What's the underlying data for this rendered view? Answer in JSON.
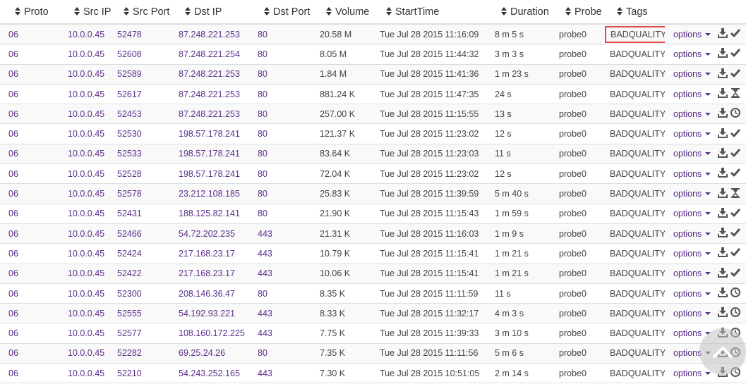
{
  "columns": [
    {
      "key": "proto",
      "label": "Proto"
    },
    {
      "key": "src_ip",
      "label": "Src IP"
    },
    {
      "key": "src_port",
      "label": "Src Port"
    },
    {
      "key": "dst_ip",
      "label": "Dst IP"
    },
    {
      "key": "dst_port",
      "label": "Dst Port"
    },
    {
      "key": "volume",
      "label": "Volume"
    },
    {
      "key": "start_time",
      "label": "StartTime"
    },
    {
      "key": "duration",
      "label": "Duration"
    },
    {
      "key": "probe",
      "label": "Probe"
    },
    {
      "key": "tags",
      "label": "Tags"
    }
  ],
  "options_label": "options",
  "highlighted_row": 0,
  "colors": {
    "link": "#5d2f8a",
    "highlight": "#e04a4a",
    "icon": "#555555"
  },
  "rows": [
    {
      "proto": "06",
      "src_ip": "10.0.0.45",
      "src_port": "52478",
      "dst_ip": "87.248.221.253",
      "dst_port": "80",
      "volume": "20.58 M",
      "start_time": "Tue Jul 28 2015 11:16:09",
      "duration": "8 m 5 s",
      "probe": "probe0",
      "tags": "BADQUALITY",
      "status": "check-icon"
    },
    {
      "proto": "06",
      "src_ip": "10.0.0.45",
      "src_port": "52608",
      "dst_ip": "87.248.221.254",
      "dst_port": "80",
      "volume": "8.05 M",
      "start_time": "Tue Jul 28 2015 11:44:32",
      "duration": "3 m 3 s",
      "probe": "probe0",
      "tags": "BADQUALITY",
      "status": "check-icon"
    },
    {
      "proto": "06",
      "src_ip": "10.0.0.45",
      "src_port": "52589",
      "dst_ip": "87.248.221.253",
      "dst_port": "80",
      "volume": "1.84 M",
      "start_time": "Tue Jul 28 2015 11:41:36",
      "duration": "1 m 23 s",
      "probe": "probe0",
      "tags": "BADQUALITY",
      "status": "check-icon"
    },
    {
      "proto": "06",
      "src_ip": "10.0.0.45",
      "src_port": "52617",
      "dst_ip": "87.248.221.253",
      "dst_port": "80",
      "volume": "881.24 K",
      "start_time": "Tue Jul 28 2015 11:47:35",
      "duration": "24 s",
      "probe": "probe0",
      "tags": "BADQUALITY",
      "status": "hourglass-icon"
    },
    {
      "proto": "06",
      "src_ip": "10.0.0.45",
      "src_port": "52453",
      "dst_ip": "87.248.221.253",
      "dst_port": "80",
      "volume": "257.00 K",
      "start_time": "Tue Jul 28 2015 11:15:55",
      "duration": "13 s",
      "probe": "probe0",
      "tags": "BADQUALITY",
      "status": "clock-icon"
    },
    {
      "proto": "06",
      "src_ip": "10.0.0.45",
      "src_port": "52530",
      "dst_ip": "198.57.178.241",
      "dst_port": "80",
      "volume": "121.37 K",
      "start_time": "Tue Jul 28 2015 11:23:02",
      "duration": "12 s",
      "probe": "probe0",
      "tags": "BADQUALITY",
      "status": "check-icon"
    },
    {
      "proto": "06",
      "src_ip": "10.0.0.45",
      "src_port": "52533",
      "dst_ip": "198.57.178.241",
      "dst_port": "80",
      "volume": "83.64 K",
      "start_time": "Tue Jul 28 2015 11:23:03",
      "duration": "11 s",
      "probe": "probe0",
      "tags": "BADQUALITY",
      "status": "check-icon"
    },
    {
      "proto": "06",
      "src_ip": "10.0.0.45",
      "src_port": "52528",
      "dst_ip": "198.57.178.241",
      "dst_port": "80",
      "volume": "72.04 K",
      "start_time": "Tue Jul 28 2015 11:23:02",
      "duration": "12 s",
      "probe": "probe0",
      "tags": "BADQUALITY",
      "status": "check-icon"
    },
    {
      "proto": "06",
      "src_ip": "10.0.0.45",
      "src_port": "52578",
      "dst_ip": "23.212.108.185",
      "dst_port": "80",
      "volume": "25.83 K",
      "start_time": "Tue Jul 28 2015 11:39:59",
      "duration": "5 m 40 s",
      "probe": "probe0",
      "tags": "BADQUALITY",
      "status": "hourglass-icon"
    },
    {
      "proto": "06",
      "src_ip": "10.0.0.45",
      "src_port": "52431",
      "dst_ip": "188.125.82.141",
      "dst_port": "80",
      "volume": "21.90 K",
      "start_time": "Tue Jul 28 2015 11:15:43",
      "duration": "1 m 59 s",
      "probe": "probe0",
      "tags": "BADQUALITY",
      "status": "check-icon"
    },
    {
      "proto": "06",
      "src_ip": "10.0.0.45",
      "src_port": "52466",
      "dst_ip": "54.72.202.235",
      "dst_port": "443",
      "volume": "21.31 K",
      "start_time": "Tue Jul 28 2015 11:16:03",
      "duration": "1 m 9 s",
      "probe": "probe0",
      "tags": "BADQUALITY",
      "status": "check-icon"
    },
    {
      "proto": "06",
      "src_ip": "10.0.0.45",
      "src_port": "52424",
      "dst_ip": "217.168.23.17",
      "dst_port": "443",
      "volume": "10.79 K",
      "start_time": "Tue Jul 28 2015 11:15:41",
      "duration": "1 m 21 s",
      "probe": "probe0",
      "tags": "BADQUALITY",
      "status": "check-icon"
    },
    {
      "proto": "06",
      "src_ip": "10.0.0.45",
      "src_port": "52422",
      "dst_ip": "217.168.23.17",
      "dst_port": "443",
      "volume": "10.06 K",
      "start_time": "Tue Jul 28 2015 11:15:41",
      "duration": "1 m 21 s",
      "probe": "probe0",
      "tags": "BADQUALITY",
      "status": "check-icon"
    },
    {
      "proto": "06",
      "src_ip": "10.0.0.45",
      "src_port": "52300",
      "dst_ip": "208.146.36.47",
      "dst_port": "80",
      "volume": "8.35 K",
      "start_time": "Tue Jul 28 2015 11:11:59",
      "duration": "11 s",
      "probe": "probe0",
      "tags": "BADQUALITY",
      "status": "clock-icon"
    },
    {
      "proto": "06",
      "src_ip": "10.0.0.45",
      "src_port": "52555",
      "dst_ip": "54.192.93.221",
      "dst_port": "443",
      "volume": "8.33 K",
      "start_time": "Tue Jul 28 2015 11:32:17",
      "duration": "4 m 3 s",
      "probe": "probe0",
      "tags": "BADQUALITY",
      "status": "clock-icon"
    },
    {
      "proto": "06",
      "src_ip": "10.0.0.45",
      "src_port": "52577",
      "dst_ip": "108.160.172.225",
      "dst_port": "443",
      "volume": "7.75 K",
      "start_time": "Tue Jul 28 2015 11:39:33",
      "duration": "3 m 10 s",
      "probe": "probe0",
      "tags": "BADQUALITY",
      "status": "clock-icon"
    },
    {
      "proto": "06",
      "src_ip": "10.0.0.45",
      "src_port": "52282",
      "dst_ip": "69.25.24.26",
      "dst_port": "80",
      "volume": "7.35 K",
      "start_time": "Tue Jul 28 2015 11:11:56",
      "duration": "5 m 6 s",
      "probe": "probe0",
      "tags": "BADQUALITY",
      "status": "clock-icon"
    },
    {
      "proto": "06",
      "src_ip": "10.0.0.45",
      "src_port": "52210",
      "dst_ip": "54.243.252.165",
      "dst_port": "443",
      "volume": "7.30 K",
      "start_time": "Tue Jul 28 2015 10:51:05",
      "duration": "2 m 14 s",
      "probe": "probe0",
      "tags": "BADQUALITY",
      "status": "clock-icon"
    }
  ]
}
